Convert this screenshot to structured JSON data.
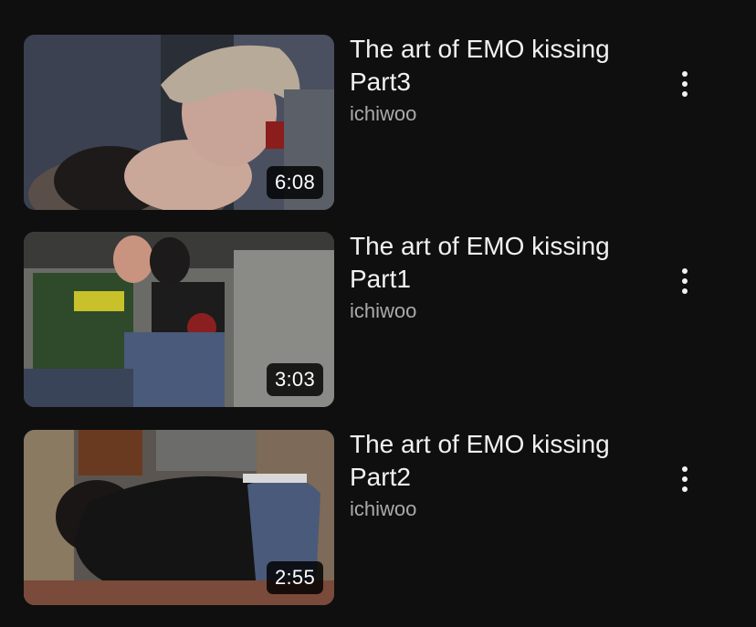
{
  "colors": {
    "background": "#0f0f0f",
    "title_text": "#f1f1f1",
    "channel_text": "#aaaaaa",
    "duration_badge": "#000000"
  },
  "videos": [
    {
      "title": "The art of EMO kissing\nPart3",
      "channel": "ichiwoo",
      "duration": "6:08",
      "menu_icon": "more-vert-icon"
    },
    {
      "title": "The art of EMO kissing\nPart1",
      "channel": "ichiwoo",
      "duration": "3:03",
      "menu_icon": "more-vert-icon"
    },
    {
      "title": "The art of EMO kissing\nPart2",
      "channel": "ichiwoo",
      "duration": "2:55",
      "menu_icon": "more-vert-icon"
    }
  ]
}
